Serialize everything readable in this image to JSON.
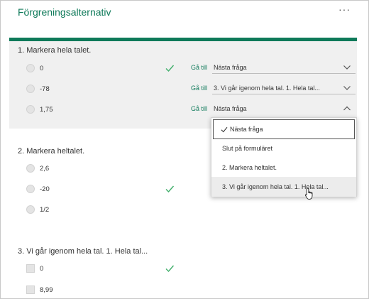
{
  "header": {
    "title": "Förgreningsalternativ",
    "more_label": "···"
  },
  "goto_label": "Gå till",
  "questions": [
    {
      "title": "1. Markera hela talet.",
      "options": [
        {
          "label": "0",
          "correct": true,
          "goto": "Nästa fråga"
        },
        {
          "label": "-78",
          "correct": false,
          "goto": "3. Vi går igenom hela tal. 1. Hela tal..."
        },
        {
          "label": "1,75",
          "correct": false,
          "goto": "Nästa fråga"
        }
      ]
    },
    {
      "title": "2. Markera heltalet.",
      "options": [
        {
          "label": "2,6",
          "correct": false
        },
        {
          "label": "-20",
          "correct": true
        },
        {
          "label": "1/2",
          "correct": false
        }
      ]
    },
    {
      "title": "3. Vi går igenom hela tal. 1. Hela tal...",
      "options": [
        {
          "label": "0",
          "correct": true
        },
        {
          "label": "8,99",
          "correct": false
        }
      ]
    }
  ],
  "dropdown": {
    "items": [
      {
        "label": "Nästa fråga",
        "selected": true
      },
      {
        "label": "Slut på formuläret"
      },
      {
        "label": "2. Markera heltalet."
      },
      {
        "label": "3. Vi går igenom hela tal. 1. Hela tal...",
        "hovered": true
      }
    ]
  },
  "colors": {
    "accent": "#0f7a5a",
    "question_bg": "#f0f0f0",
    "tick": "#3fae6a"
  }
}
